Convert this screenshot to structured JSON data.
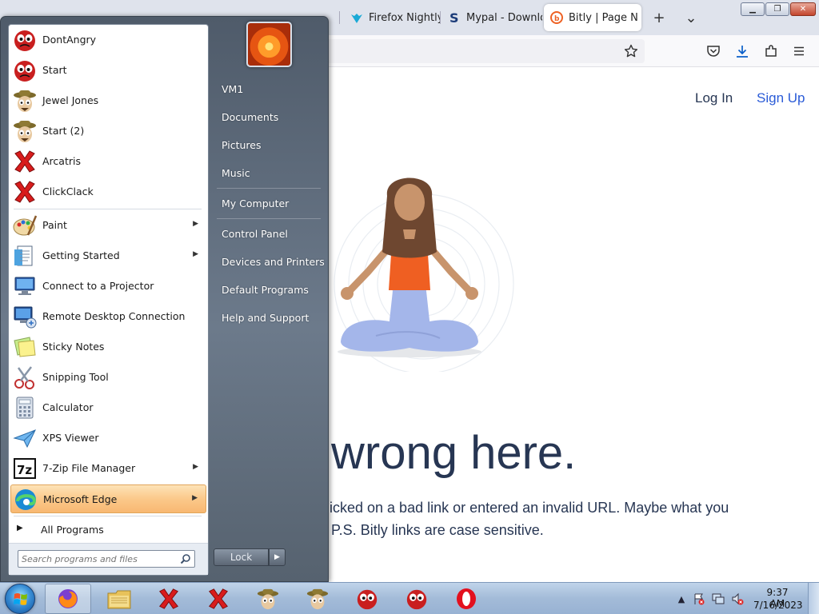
{
  "browser": {
    "tabs": [
      {
        "label": "Firefox Nightly |",
        "icon": "firefox-nightly-icon"
      },
      {
        "label": "Mypal - Downlo",
        "icon": "mypal-icon"
      },
      {
        "label": "Bitly | Page N",
        "icon": "bitly-icon",
        "active": true
      }
    ],
    "new_tab_glyph": "+",
    "list_tabs_glyph": "⌄",
    "colors": {
      "tabbar": "#dfe3ec",
      "accent_link": "#2a5bd7",
      "text_dark": "#273653"
    }
  },
  "page": {
    "nav": {
      "login": "Log In",
      "signup": "Sign Up"
    },
    "headline": "wrong here.",
    "body_line_1": "licked on a bad link or entered an invalid URL. Maybe what you",
    "body_line_2": "P.S. Bitly links are case sensitive."
  },
  "start_menu": {
    "pinned": [
      {
        "label": "DontAngry",
        "icon": "angry-ball-icon"
      },
      {
        "label": "Start",
        "icon": "angry-ball-icon"
      },
      {
        "label": "Jewel Jones",
        "icon": "explorer-character-icon"
      },
      {
        "label": "Start (2)",
        "icon": "explorer-character-icon"
      },
      {
        "label": "Arcatris",
        "icon": "red-x-icon"
      },
      {
        "label": "ClickClack",
        "icon": "red-x-icon"
      }
    ],
    "recent": [
      {
        "label": "Paint",
        "icon": "paint-palette-icon",
        "has_submenu": true
      },
      {
        "label": "Getting Started",
        "icon": "getting-started-icon",
        "has_submenu": true
      },
      {
        "label": "Connect to a Projector",
        "icon": "projector-icon",
        "has_submenu": false
      },
      {
        "label": "Remote Desktop Connection",
        "icon": "remote-desktop-icon",
        "has_submenu": false
      },
      {
        "label": "Sticky Notes",
        "icon": "sticky-notes-icon",
        "has_submenu": false
      },
      {
        "label": "Snipping Tool",
        "icon": "scissors-icon",
        "has_submenu": false
      },
      {
        "label": "Calculator",
        "icon": "calculator-icon",
        "has_submenu": false
      },
      {
        "label": "XPS Viewer",
        "icon": "xps-viewer-icon",
        "has_submenu": false
      },
      {
        "label": "7-Zip File Manager",
        "icon": "seven-zip-icon",
        "has_submenu": true
      },
      {
        "label": "Microsoft Edge",
        "icon": "edge-icon",
        "has_submenu": true,
        "highlighted": true
      }
    ],
    "all_programs": "All Programs",
    "search_placeholder": "Search programs and files",
    "right_items": [
      {
        "label": "VM1"
      },
      {
        "label": "Documents"
      },
      {
        "label": "Pictures"
      },
      {
        "label": "Music"
      },
      {
        "label": "My Computer"
      },
      {
        "label": "Control Panel"
      },
      {
        "label": "Devices and Printers"
      },
      {
        "label": "Default Programs"
      },
      {
        "label": "Help and Support"
      }
    ],
    "lock_label": "Lock",
    "lock_arrow": "▶"
  },
  "taskbar": {
    "buttons": [
      {
        "icon": "firefox-icon",
        "pressed": true
      },
      {
        "icon": "file-explorer-icon"
      },
      {
        "icon": "red-x-icon"
      },
      {
        "icon": "red-x-icon"
      },
      {
        "icon": "explorer-character-icon"
      },
      {
        "icon": "explorer-character-icon"
      },
      {
        "icon": "angry-ball-icon"
      },
      {
        "icon": "angry-ball-icon"
      },
      {
        "icon": "opera-icon"
      }
    ],
    "tray": {
      "show_hidden": "▲",
      "time": "9:37 AM",
      "date": "7/16/2023"
    }
  }
}
